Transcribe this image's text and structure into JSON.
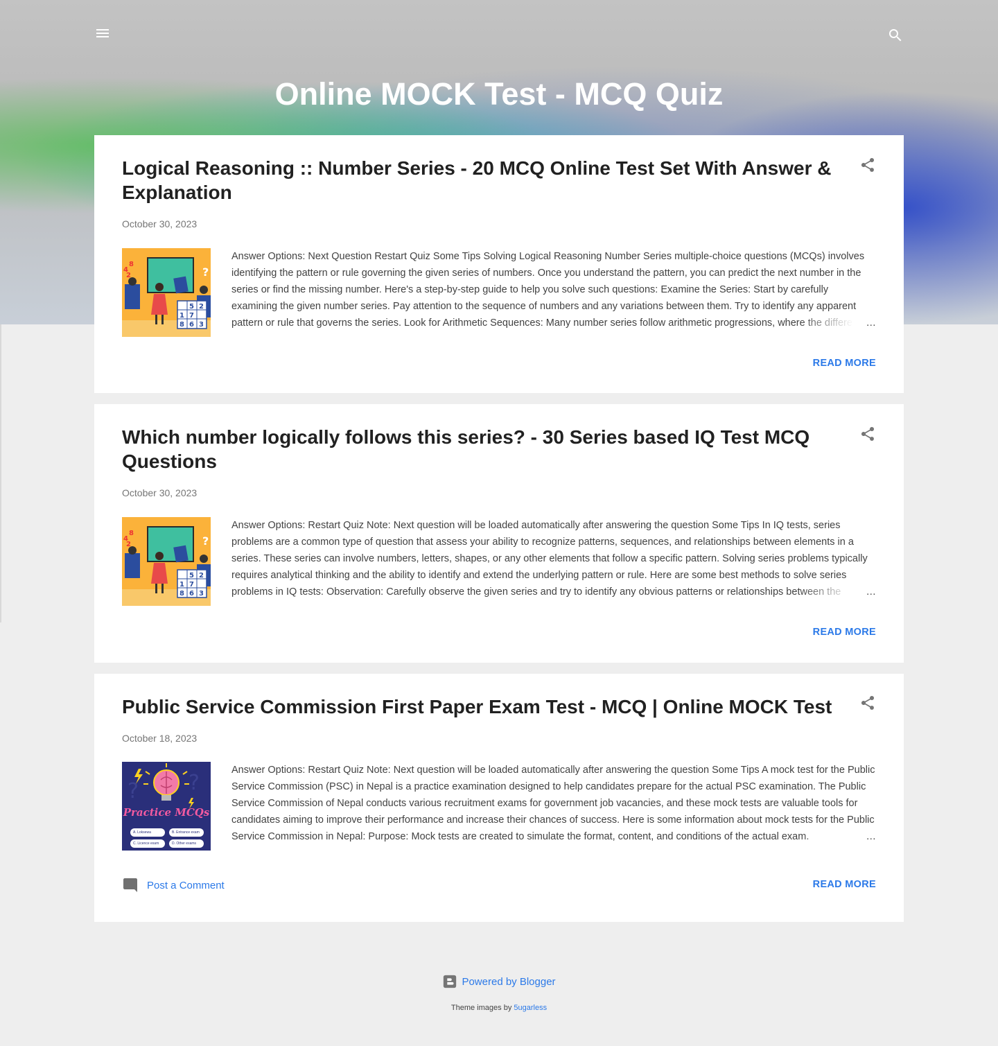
{
  "blog": {
    "title": "Online MOCK Test - MCQ Quiz"
  },
  "posts": [
    {
      "title": "Logical Reasoning :: Number Series - 20 MCQ Online Test Set With Answer & Explanation",
      "date": "October 30, 2023",
      "snippet": "Answer Options: Next Question Restart Quiz Some Tips Solving Logical Reasoning Number Series multiple-choice questions (MCQs) involves identifying the pattern or rule governing the given series of numbers. Once you understand the pattern, you can predict the next number in the series or find the missing number. Here's a step-by-step guide to help you solve such questions: Examine the Series: Start by carefully examining the given number series. Pay attention to the sequence of numbers and any variations between them. Try to identify any apparent pattern or rule that governs the series. Look for Arithmetic Sequences: Many number series follow arithmetic progressions, where the difference between consecutive numbers is constant.",
      "ellipsis": "…",
      "read_more": "READ MORE"
    },
    {
      "title": "Which number logically follows this series? - 30 Series based IQ Test MCQ Questions",
      "date": "October 30, 2023",
      "snippet": "Answer Options: Restart Quiz Note: Next question will be loaded automatically after answering the question Some Tips In IQ tests, series problems are a common type of question that assess your ability to recognize patterns, sequences, and relationships between elements in a series. These series can involve numbers, letters, shapes, or any other elements that follow a specific pattern. Solving series problems typically requires analytical thinking and the ability to identify and extend the underlying pattern or rule. Here are some best methods to solve series problems in IQ tests: Observation: Carefully observe the given series and try to identify any obvious patterns or relationships between the elements.",
      "ellipsis": "…",
      "read_more": "READ MORE"
    },
    {
      "title": "Public Service Commission First Paper Exam Test - MCQ | Online MOCK Test",
      "date": "October 18, 2023",
      "snippet": "Answer Options: Restart Quiz Note: Next question will be loaded automatically after answering the question Some Tips A mock test for the Public Service Commission (PSC) in Nepal is a practice examination designed to help candidates prepare for the actual PSC examination. The Public Service Commission of Nepal conducts various recruitment exams for government job vacancies, and these mock tests are valuable tools for candidates aiming to improve their performance and increase their chances of success. Here is some information about mock tests for the Public Service Commission in Nepal: Purpose: Mock tests are created to simulate the format, content, and conditions of the actual exam.",
      "ellipsis": "…",
      "read_more": "READ MORE",
      "comment_label": "Post a Comment",
      "thumb": {
        "heading": "Practice MCQs",
        "chips": [
          "A. Loksewa",
          "B. Entrance exam",
          "C. Licence exam",
          "D. Other exams"
        ]
      }
    }
  ],
  "thumb_math": {
    "numbers": [
      "4",
      "2",
      "8"
    ],
    "grid": [
      "",
      "5",
      "2",
      "1",
      "7",
      "",
      "8",
      "6",
      "3"
    ]
  },
  "footer": {
    "powered_by": "Powered by Blogger",
    "theme_prefix": "Theme images by",
    "theme_author": "5ugarless"
  },
  "colors": {
    "accent": "#2b79e8",
    "title_text": "#212121",
    "date_text": "#757575",
    "page_bg": "#eeeeee"
  },
  "icons": {
    "menu": "hamburger-menu-icon",
    "search": "magnifier-search-icon",
    "share": "share-icon",
    "comment": "comment-bubble-icon",
    "blogger": "blogger-logo-icon"
  }
}
